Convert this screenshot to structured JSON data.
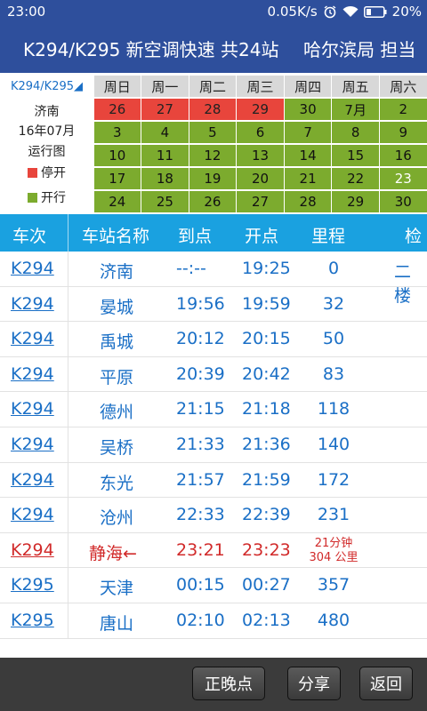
{
  "statusbar": {
    "time": "23:00",
    "speed": "0.05K/s",
    "battery": "20%"
  },
  "title": {
    "main": "K294/K295 新空调快速 共24站",
    "bureau": "哈尔滨局 担当"
  },
  "calendar": {
    "train_selector": "K294/K295◢",
    "station": "济南",
    "month": "16年07月",
    "label": "运行图",
    "legend_stop": "停开",
    "legend_run": "开行",
    "colors": {
      "stop": "#e8453c",
      "run": "#7cab2e"
    },
    "weekdays": [
      "周日",
      "周一",
      "周二",
      "周三",
      "周四",
      "周五",
      "周六"
    ],
    "weeks": [
      [
        {
          "d": "26",
          "s": "stop"
        },
        {
          "d": "27",
          "s": "stop"
        },
        {
          "d": "28",
          "s": "stop"
        },
        {
          "d": "29",
          "s": "stop"
        },
        {
          "d": "30",
          "s": "run"
        },
        {
          "d": "7月",
          "s": "run"
        },
        {
          "d": "2",
          "s": "run"
        }
      ],
      [
        {
          "d": "3",
          "s": "run"
        },
        {
          "d": "4",
          "s": "run"
        },
        {
          "d": "5",
          "s": "run"
        },
        {
          "d": "6",
          "s": "run"
        },
        {
          "d": "7",
          "s": "run"
        },
        {
          "d": "8",
          "s": "run"
        },
        {
          "d": "9",
          "s": "run"
        }
      ],
      [
        {
          "d": "10",
          "s": "run"
        },
        {
          "d": "11",
          "s": "run"
        },
        {
          "d": "12",
          "s": "run"
        },
        {
          "d": "13",
          "s": "run"
        },
        {
          "d": "14",
          "s": "run"
        },
        {
          "d": "15",
          "s": "run"
        },
        {
          "d": "16",
          "s": "run"
        }
      ],
      [
        {
          "d": "17",
          "s": "run"
        },
        {
          "d": "18",
          "s": "run"
        },
        {
          "d": "19",
          "s": "run"
        },
        {
          "d": "20",
          "s": "run"
        },
        {
          "d": "21",
          "s": "run"
        },
        {
          "d": "22",
          "s": "run"
        },
        {
          "d": "23",
          "s": "today"
        }
      ],
      [
        {
          "d": "24",
          "s": "run"
        },
        {
          "d": "25",
          "s": "run"
        },
        {
          "d": "26",
          "s": "run"
        },
        {
          "d": "27",
          "s": "run"
        },
        {
          "d": "28",
          "s": "run"
        },
        {
          "d": "29",
          "s": "run"
        },
        {
          "d": "30",
          "s": "run"
        }
      ]
    ]
  },
  "table": {
    "headers": [
      "车次",
      "车站名称",
      "到点",
      "开点",
      "里程",
      "检票"
    ],
    "rows": [
      {
        "train": "K294",
        "station": "济南",
        "arrive": "--:--",
        "depart": "19:25",
        "mileage": "0",
        "gate": "二楼"
      },
      {
        "train": "K294",
        "station": "晏城",
        "arrive": "19:56",
        "depart": "19:59",
        "mileage": "32",
        "gate": ""
      },
      {
        "train": "K294",
        "station": "禹城",
        "arrive": "20:12",
        "depart": "20:15",
        "mileage": "50",
        "gate": ""
      },
      {
        "train": "K294",
        "station": "平原",
        "arrive": "20:39",
        "depart": "20:42",
        "mileage": "83",
        "gate": ""
      },
      {
        "train": "K294",
        "station": "德州",
        "arrive": "21:15",
        "depart": "21:18",
        "mileage": "118",
        "gate": ""
      },
      {
        "train": "K294",
        "station": "吴桥",
        "arrive": "21:33",
        "depart": "21:36",
        "mileage": "140",
        "gate": ""
      },
      {
        "train": "K294",
        "station": "东光",
        "arrive": "21:57",
        "depart": "21:59",
        "mileage": "172",
        "gate": ""
      },
      {
        "train": "K294",
        "station": "沧州",
        "arrive": "22:33",
        "depart": "22:39",
        "mileage": "231",
        "gate": ""
      },
      {
        "train": "K294",
        "station": "静海←",
        "arrive": "23:21",
        "depart": "23:23",
        "mileage_line1": "21分钟",
        "mileage_line2": "304 公里",
        "gate": "",
        "highlight": true
      },
      {
        "train": "K295",
        "station": "天津",
        "arrive": "00:15",
        "depart": "00:27",
        "mileage": "357",
        "gate": ""
      },
      {
        "train": "K295",
        "station": "唐山",
        "arrive": "02:10",
        "depart": "02:13",
        "mileage": "480",
        "gate": ""
      }
    ]
  },
  "bottom": {
    "delay_button": "正晚点",
    "share_button": "分享",
    "back_button": "返回"
  }
}
